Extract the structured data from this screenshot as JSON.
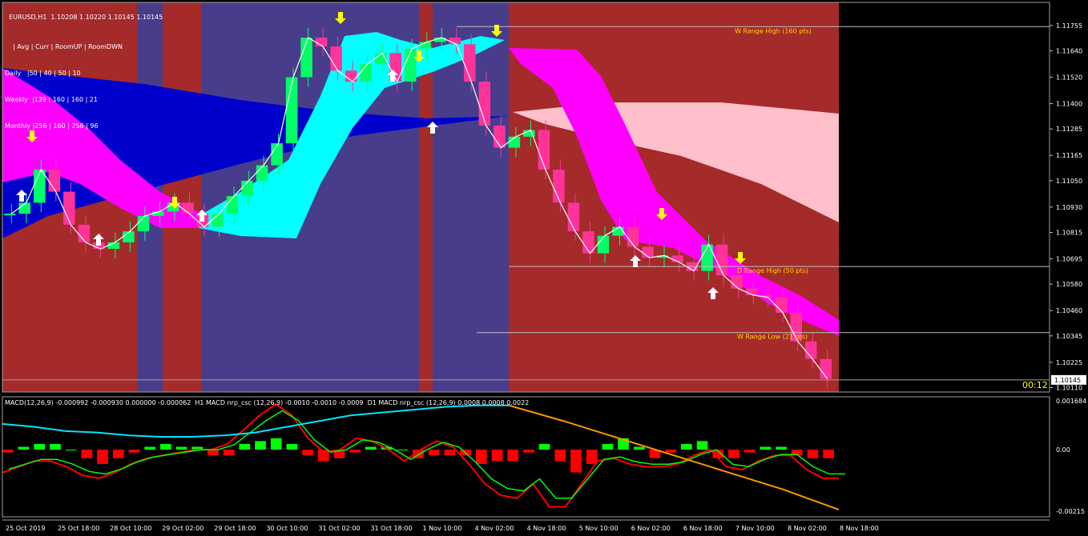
{
  "header": {
    "symbol": "EURUSD,H1",
    "ohlc": "1.10208 1.10220 1.10145 1.10145"
  },
  "info_table": {
    "header": "| Avg | Curr | RoomUP | RoomDWN",
    "rows": [
      "Daily   |50 | 40 | 50 | 10",
      "Weekly  |139 | 160 | 160 | 21",
      "Monthly |256 | 160 | 256 | 96"
    ]
  },
  "timer": "00:12",
  "macd_caption": "MACD(12,26,9) -0.000992 -0.000930 0.000000 -0.000062  H1 MACD nrp_csc (12,26,9) -0.0010 -0.0010 -0.0009  D1 MACD nrp_csc (12,26,9) 0.0008 0.0008 0.0022",
  "colors": {
    "background": "#000000",
    "bull_session": "#a52a2a",
    "bear_session": "#483d8b",
    "up_candle": "#00ff66",
    "down_candle": "#ff3399",
    "cyan_band": "#00ffff",
    "blue_band": "#0000cd",
    "magenta_band": "#ff00ff",
    "pink_band": "#ffc0cb",
    "range_line": "#c0c0c0",
    "range_text": "#ffd700",
    "arrow_up": "#ffffff",
    "arrow_down": "#ffff00",
    "macd_pos": "#00ff00",
    "macd_neg": "#ff0000",
    "macd_cyan": "#00e5ff",
    "macd_orange": "#ff9900"
  },
  "chart_data": [
    {
      "type": "candlestick",
      "title": "EURUSD,H1",
      "price_axis_ticks": [
        "1.11755",
        "1.11640",
        "1.11520",
        "1.11400",
        "1.11285",
        "1.11165",
        "1.11050",
        "1.10930",
        "1.10815",
        "1.10695",
        "1.10580",
        "1.10460",
        "1.10345",
        "1.10225",
        "1.10110"
      ],
      "current_price": "1.10145",
      "ylim": [
        1.1009,
        1.1186
      ],
      "time_axis_ticks": [
        "25 Oct 2019",
        "25 Oct 18:00",
        "28 Oct 10:00",
        "29 Oct 02:00",
        "29 Oct 18:00",
        "30 Oct 10:00",
        "31 Oct 02:00",
        "31 Oct 18:00",
        "1 Nov 10:00",
        "4 Nov 02:00",
        "4 Nov 18:00",
        "5 Nov 10:00",
        "6 Nov 02:00",
        "6 Nov 18:00",
        "7 Nov 10:00",
        "8 Nov 02:00",
        "8 Nov 18:00"
      ],
      "range_levels": [
        {
          "label": "W Range High (160 pts)",
          "price": 1.1175
        },
        {
          "label": "D Range High (50 pts)",
          "price": 1.1066
        },
        {
          "label": "W Range Low (21 pts)",
          "price": 1.1036
        }
      ],
      "close_series": [
        1.109,
        1.1095,
        1.111,
        1.11,
        1.1085,
        1.1077,
        1.1074,
        1.1077,
        1.1082,
        1.1089,
        1.1091,
        1.1095,
        1.109,
        1.1084,
        1.109,
        1.1098,
        1.1105,
        1.1112,
        1.1122,
        1.1152,
        1.117,
        1.1166,
        1.1155,
        1.115,
        1.1158,
        1.1163,
        1.115,
        1.1165,
        1.1168,
        1.117,
        1.1167,
        1.115,
        1.113,
        1.112,
        1.1125,
        1.1128,
        1.111,
        1.1095,
        1.1082,
        1.1072,
        1.108,
        1.1084,
        1.1075,
        1.107,
        1.1071,
        1.1068,
        1.1064,
        1.1076,
        1.1062,
        1.1056,
        1.1053,
        1.1052,
        1.1045,
        1.1032,
        1.1024,
        1.1015
      ]
    },
    {
      "type": "bar",
      "title": "MACD(12,26,9)",
      "price_axis_ticks": [
        "0.001684",
        "0.00",
        "-0.00215"
      ],
      "ylim": [
        -0.00235,
        0.00185
      ],
      "histogram": [
        -0.0001,
        0.0001,
        0.0002,
        0.0002,
        0.0,
        -0.0003,
        -0.0005,
        -0.0003,
        -0.0001,
        0.0001,
        0.0002,
        0.0001,
        0.0001,
        -0.0002,
        -0.0002,
        0.0002,
        0.0003,
        0.0004,
        0.0002,
        -0.0002,
        -0.0004,
        -0.0003,
        -0.0001,
        0.0001,
        0.0001,
        0.0,
        -0.0003,
        -0.0002,
        -0.0002,
        -0.0002,
        -0.0005,
        -0.0004,
        -0.0004,
        -0.0001,
        0.0002,
        -0.0004,
        -0.0008,
        -0.0005,
        0.0002,
        0.0004,
        0.0001,
        -0.0003,
        -0.0001,
        0.0002,
        0.0003,
        -0.0003,
        -0.0003,
        -0.0001,
        0.0001,
        0.0001,
        -0.0002,
        -0.0003,
        -0.0003
      ],
      "macd_line": [
        -0.0008,
        -0.0006,
        -0.0004,
        -0.0004,
        -0.0006,
        -0.0009,
        -0.001,
        -0.0008,
        -0.0005,
        -0.0003,
        -0.0002,
        -0.0001,
        0.0,
        0.0,
        0.0002,
        0.0007,
        0.0012,
        0.0016,
        0.0012,
        0.0004,
        -0.0001,
        0.0,
        0.0004,
        0.0003,
        0.0,
        -0.0004,
        0.0,
        0.0003,
        0.0001,
        -0.0005,
        -0.0012,
        -0.0016,
        -0.0017,
        -0.0012,
        -0.002,
        -0.002,
        -0.0012,
        -0.0004,
        -0.0003,
        -0.0005,
        -0.0006,
        -0.0006,
        -0.0005,
        -0.0002,
        0.0,
        -0.0006,
        -0.0007,
        -0.0004,
        -0.0002,
        -0.0002,
        -0.0007,
        -0.001,
        -0.001
      ],
      "cyan_line": [
        0.0009,
        0.0008,
        0.00065,
        0.0006,
        0.0005,
        0.00045,
        0.00045,
        0.0005,
        0.0006,
        0.0008,
        0.001,
        0.0012,
        0.0013,
        0.0014,
        0.0015,
        0.00155,
        0.00155
      ],
      "orange_line": [
        0.00155,
        0.001,
        0.0004,
        -0.0002,
        -0.0008,
        -0.0014,
        -0.0021
      ]
    }
  ]
}
